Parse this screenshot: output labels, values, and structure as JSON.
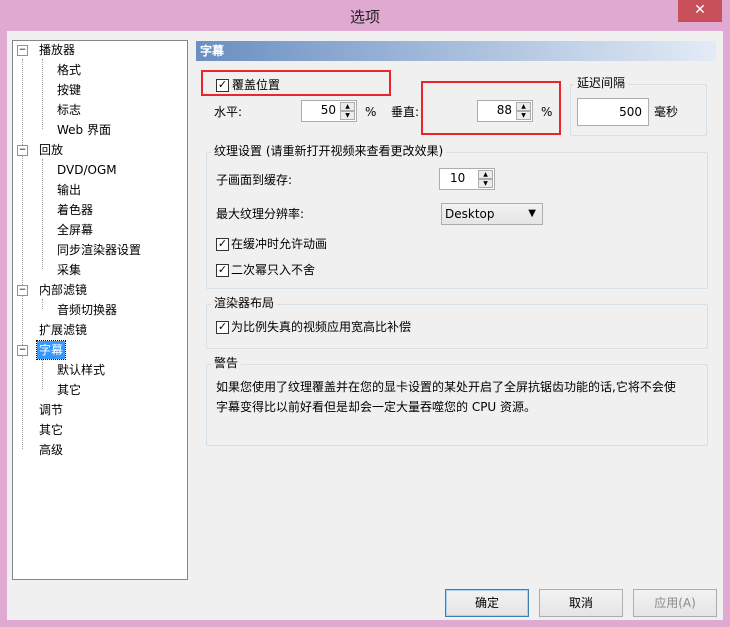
{
  "window": {
    "title": "选项",
    "close_glyph": "✕"
  },
  "tree": {
    "items": [
      {
        "label": "播放器",
        "expander": "−"
      },
      {
        "label": "格式"
      },
      {
        "label": "按键"
      },
      {
        "label": "标志"
      },
      {
        "label": "Web 界面"
      },
      {
        "label": "回放",
        "expander": "−"
      },
      {
        "label": "DVD/OGM"
      },
      {
        "label": "输出"
      },
      {
        "label": "着色器"
      },
      {
        "label": "全屏幕"
      },
      {
        "label": "同步渲染器设置"
      },
      {
        "label": "采集"
      },
      {
        "label": "内部滤镜",
        "expander": "−"
      },
      {
        "label": "音频切换器"
      },
      {
        "label": "扩展滤镜"
      },
      {
        "label": "字幕",
        "expander": "−",
        "selected": true
      },
      {
        "label": "默认样式"
      },
      {
        "label": "其它"
      },
      {
        "label": "调节"
      },
      {
        "label": "其它"
      },
      {
        "label": "高级"
      }
    ]
  },
  "panel": {
    "header": "字幕",
    "override": {
      "checkbox_label": "覆盖位置",
      "checked": true,
      "horizontal_label": "水平:",
      "horizontal_value": "50",
      "horizontal_unit": "%",
      "vertical_label": "垂直:",
      "vertical_value": "88",
      "vertical_unit": "%"
    },
    "delay": {
      "group_label": "延迟间隔",
      "value": "500",
      "unit": "毫秒"
    },
    "texture": {
      "group_label": "纹理设置 (请重新打开视频来查看更改效果)",
      "buffer_label": "子画面到缓存:",
      "buffer_value": "10",
      "maxres_label": "最大纹理分辨率:",
      "maxres_value": "Desktop",
      "anim_label": "在缓冲时允许动画",
      "anim_checked": true,
      "pow2_label": "二次幂只入不舍",
      "pow2_checked": true
    },
    "renderer": {
      "group_label": "渲染器布局",
      "aspect_label": "为比例失真的视频应用宽高比补偿",
      "aspect_checked": true
    },
    "warning": {
      "group_label": "警告",
      "line1": "如果您使用了纹理覆盖并在您的显卡设置的某处开启了全屏抗锯齿功能的话,它将不会使",
      "line2": "字幕变得比以前好看但是却会一定大量吞噬您的 CPU 资源。"
    }
  },
  "buttons": {
    "ok": "确定",
    "cancel": "取消",
    "apply": "应用(A)"
  },
  "check_glyph": "✓",
  "spin_up": "▲",
  "spin_down": "▼",
  "chevron": "▼"
}
